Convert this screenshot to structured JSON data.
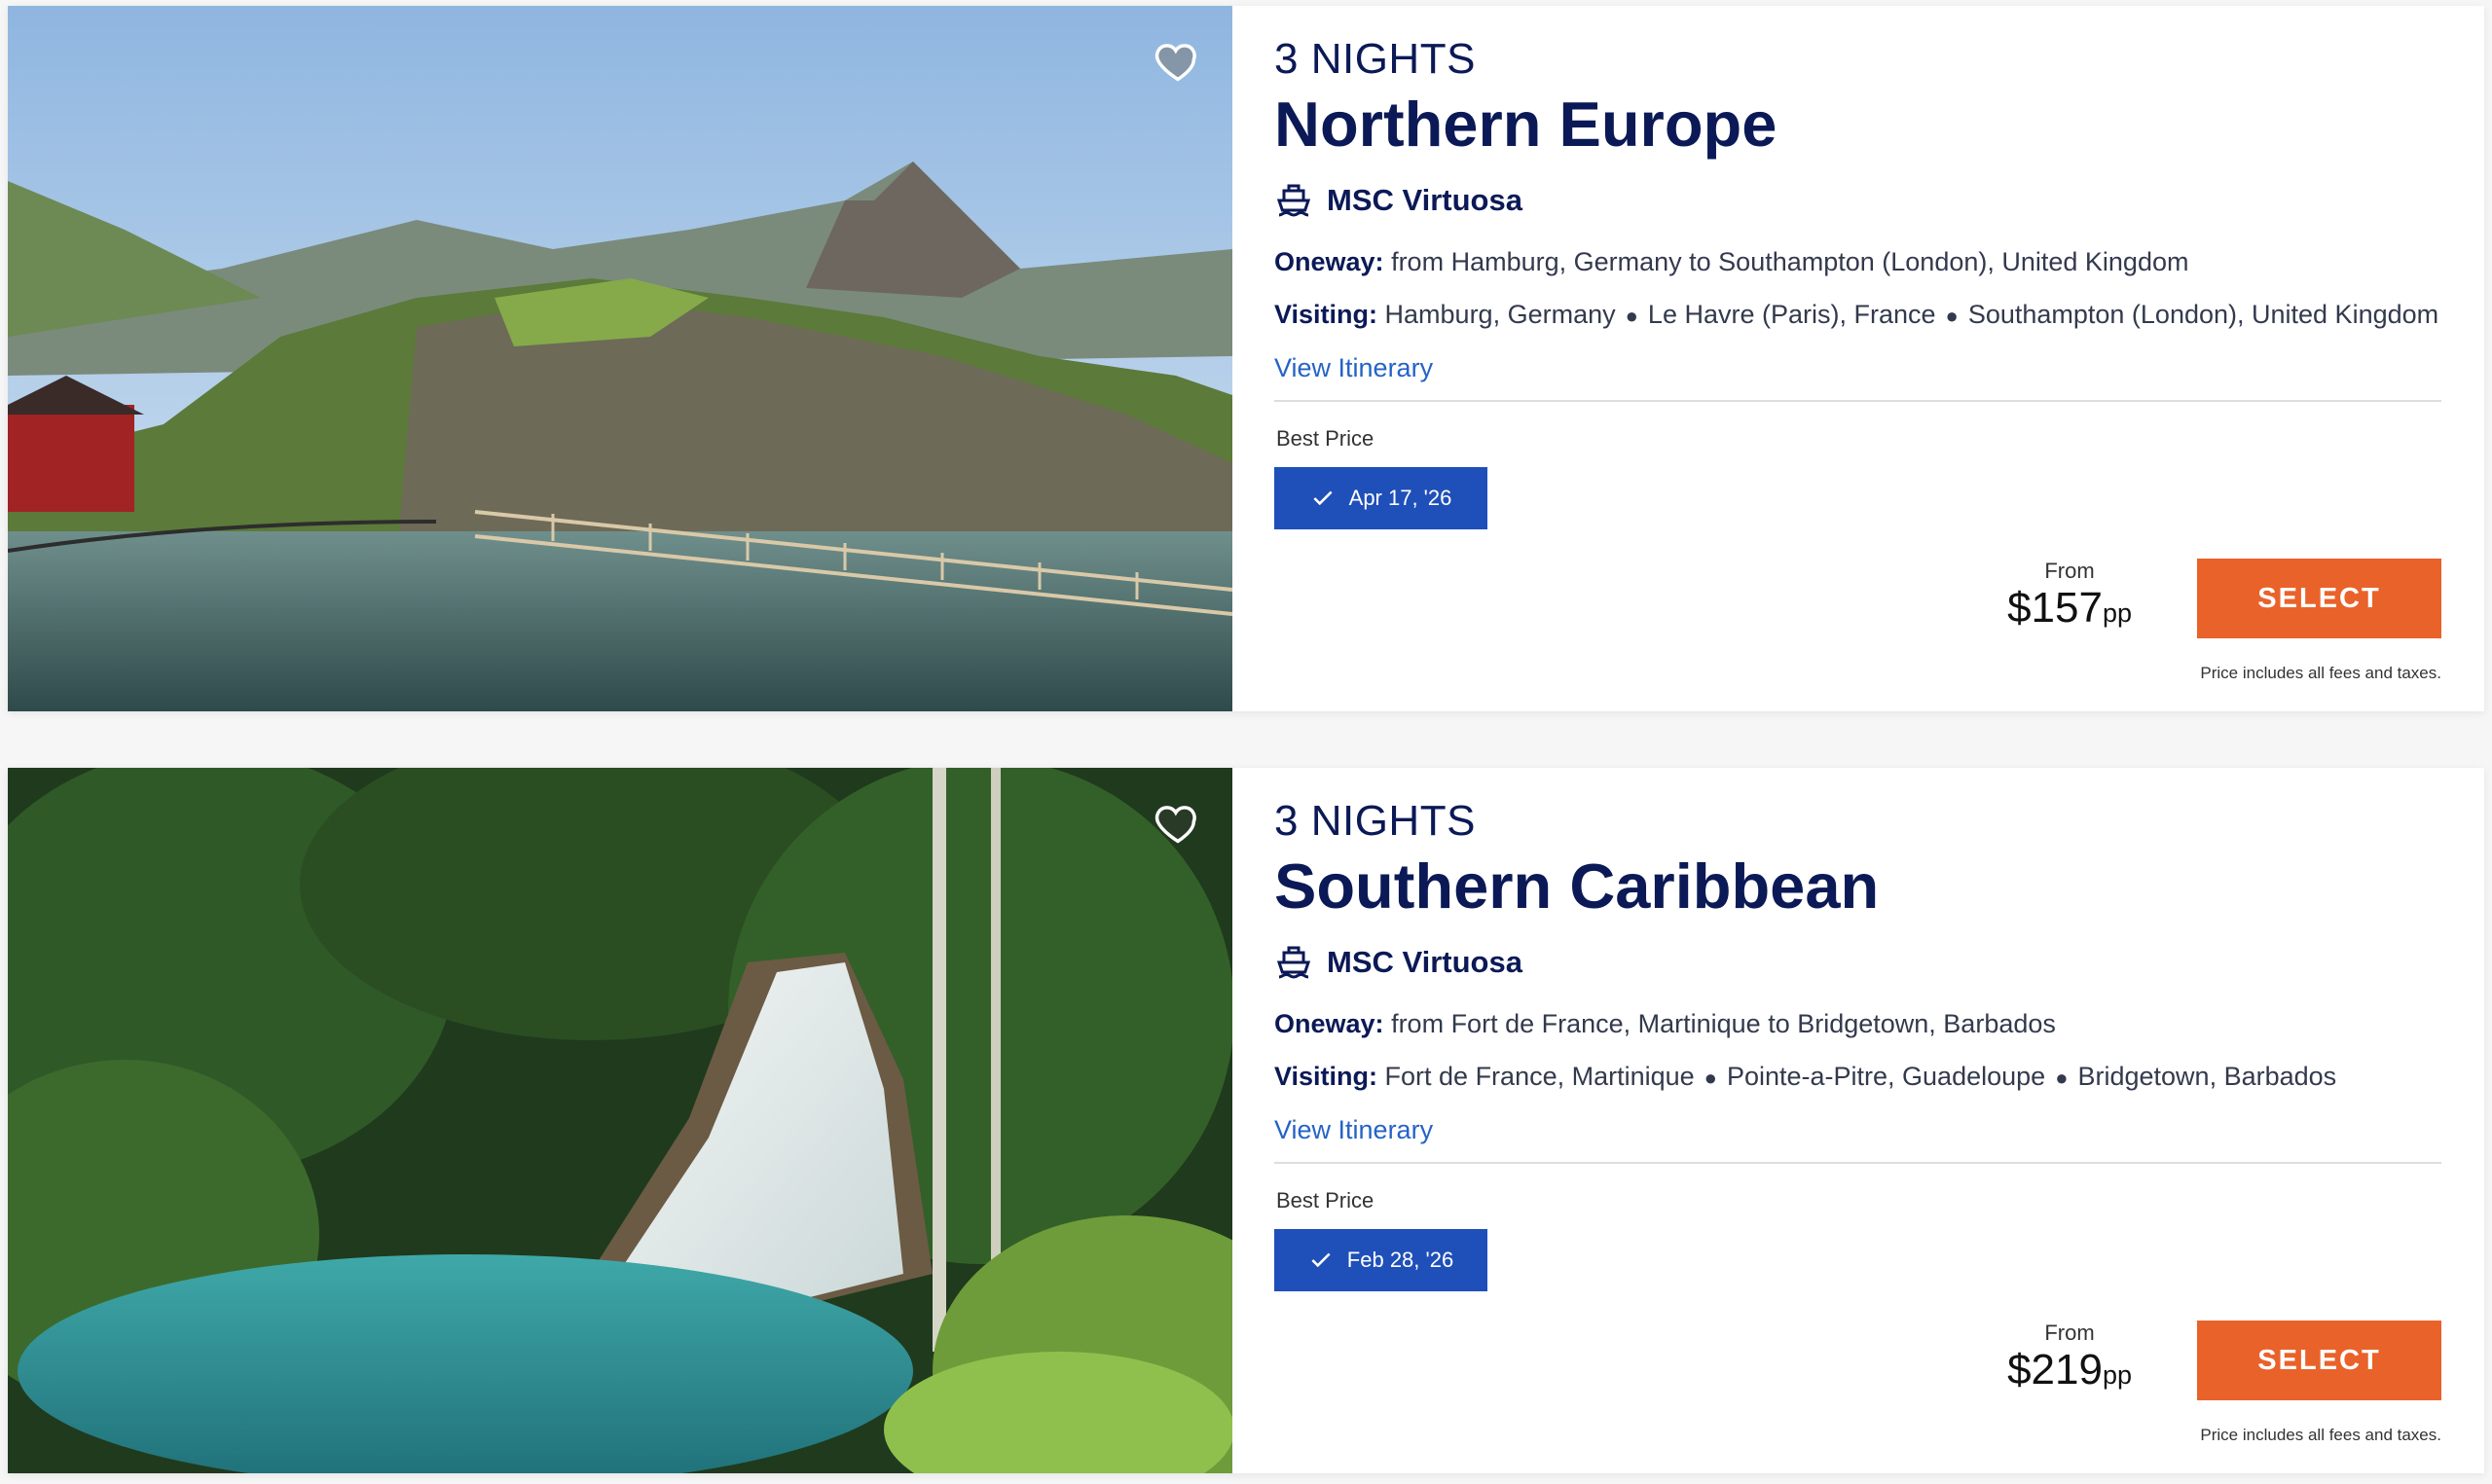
{
  "colors": {
    "navy": "#0b1a57",
    "link": "#2563c6",
    "chip": "#1f4fb8",
    "select": "#e8622a"
  },
  "cards": [
    {
      "nights": "3 NIGHTS",
      "title": "Northern Europe",
      "ship_icon": "ship-icon",
      "ship": "MSC Virtuosa",
      "oneway_label": "Oneway:",
      "oneway": "from Hamburg, Germany to Southampton (London), United Kingdom",
      "visiting_label": "Visiting:",
      "ports": [
        "Hamburg, Germany",
        "Le Havre (Paris), France",
        "Southampton (London), United Kingdom"
      ],
      "itinerary_link": "View Itinerary",
      "best_price_label": "Best Price",
      "date": "Apr 17, '26",
      "from_label": "From",
      "price": "$157",
      "per": "pp",
      "select_label": "SELECT",
      "fees_note": "Price includes all fees and taxes.",
      "image": "fjord-landscape-image",
      "favorite_icon": "heart-icon"
    },
    {
      "nights": "3 NIGHTS",
      "title": "Southern Caribbean",
      "ship_icon": "ship-icon",
      "ship": "MSC Virtuosa",
      "oneway_label": "Oneway:",
      "oneway": "from Fort de France, Martinique to Bridgetown, Barbados",
      "visiting_label": "Visiting:",
      "ports": [
        "Fort de France, Martinique",
        "Pointe-a-Pitre, Guadeloupe",
        "Bridgetown, Barbados"
      ],
      "itinerary_link": "View Itinerary",
      "best_price_label": "Best Price",
      "date": "Feb 28, '26",
      "from_label": "From",
      "price": "$219",
      "per": "pp",
      "select_label": "SELECT",
      "fees_note": "Price includes all fees and taxes.",
      "image": "waterfall-jungle-image",
      "favorite_icon": "heart-icon"
    }
  ]
}
